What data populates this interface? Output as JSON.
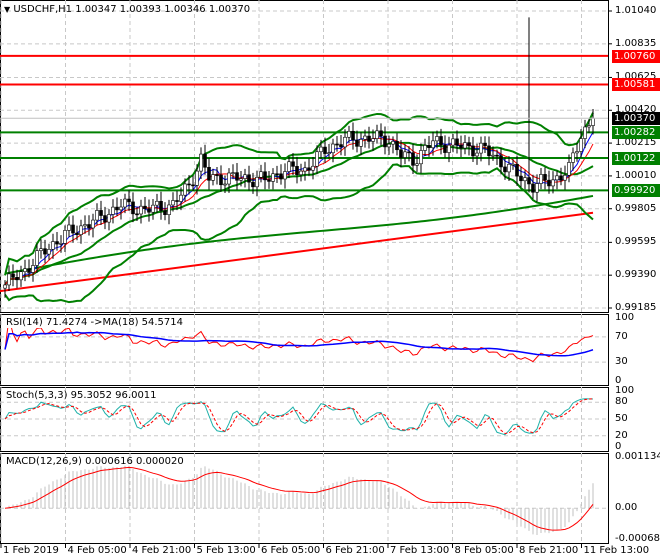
{
  "header": {
    "symbol": "USDCHF,H1",
    "ohlc": "1.00347 1.00393 1.00346 1.00370",
    "menu_icon": "triangle-down-icon"
  },
  "colors": {
    "support": "#008000",
    "resistance": "#ff0000",
    "bands": "#008000",
    "ma_fast": "#0000ff",
    "ma_slow": "#ff0000",
    "rsi": "#ff0000",
    "rsi_ma": "#0000ff",
    "stoch_main": "#20b2aa",
    "stoch_signal": "#ff0000",
    "macd_hist": "#c0c0c0",
    "macd_signal": "#ff0000",
    "current": "#000000"
  },
  "chart_data": [
    {
      "type": "candlestick",
      "title": "USDCHF,H1",
      "ylim": [
        0.99185,
        1.0104
      ],
      "yticks": [
        "1.01040",
        "1.00835",
        "1.00625",
        "1.00420",
        "1.00215",
        "1.00010",
        "0.99805",
        "0.99595",
        "0.99390",
        "0.99185"
      ],
      "close_keypoints": [
        [
          0,
          0.99329
        ],
        [
          5,
          0.99422
        ],
        [
          10,
          0.99547
        ],
        [
          15,
          0.99641
        ],
        [
          20,
          0.99703
        ],
        [
          25,
          0.99766
        ],
        [
          29,
          0.99828
        ],
        [
          35,
          0.99797
        ],
        [
          42,
          0.99828
        ],
        [
          46,
          0.99953
        ],
        [
          49,
          1.00109
        ],
        [
          51,
          0.99997
        ],
        [
          58,
          0.99997
        ],
        [
          65,
          0.99985
        ],
        [
          70,
          1.00047
        ],
        [
          75,
          1.00047
        ],
        [
          80,
          1.00172
        ],
        [
          85,
          1.00234
        ],
        [
          92,
          1.00247
        ],
        [
          96,
          1.00234
        ],
        [
          99,
          1.00141
        ],
        [
          102,
          1.00109
        ],
        [
          107,
          1.00222
        ],
        [
          112,
          1.00203
        ],
        [
          120,
          1.00172
        ],
        [
          125,
          1.00078
        ],
        [
          129,
          0.99997
        ],
        [
          132,
          0.99953
        ],
        [
          137,
          0.99985
        ],
        [
          141,
          1.00047
        ],
        [
          144,
          1.00266
        ],
        [
          147,
          1.0037
        ]
      ],
      "spike": {
        "bar": 131,
        "high": 1.01
      },
      "levels": [
        {
          "value": 1.0076,
          "label": "1.00760",
          "kind": "resistance"
        },
        {
          "value": 1.00581,
          "label": "1.00581",
          "kind": "resistance"
        },
        {
          "value": 1.00282,
          "label": "1.00282",
          "kind": "support"
        },
        {
          "value": 1.00122,
          "label": "1.00122",
          "kind": "support"
        },
        {
          "value": 0.9992,
          "label": "0.99920",
          "kind": "support"
        }
      ],
      "current": {
        "value": 1.0037,
        "label": "1.00370"
      },
      "long_ma_red": [
        0.9929,
        0.9978
      ],
      "long_ma_green": [
        0.994,
        0.999
      ]
    },
    {
      "type": "line",
      "title": "RSI(14) 71.4274  ->MA(18) 54.5714",
      "yticks": [
        "100",
        "70",
        "30",
        "0"
      ],
      "ylim": [
        0,
        100
      ]
    },
    {
      "type": "line",
      "title": "Stoch(5,3,3) 95.3052 96.0011",
      "yticks": [
        "100",
        "80",
        "50",
        "20",
        "0"
      ],
      "ylim": [
        0,
        100
      ]
    },
    {
      "type": "bar",
      "title": "MACD(12,26,9) 0.000616 0.000020",
      "yticks": [
        "0.001134",
        "0.00",
        "-0.000681"
      ],
      "ylim": [
        -0.000681,
        0.001134
      ]
    }
  ],
  "time_axis": [
    "1 Feb 2019",
    "4 Feb 05:00",
    "4 Feb 21:00",
    "5 Feb 13:00",
    "6 Feb 05:00",
    "6 Feb 21:00",
    "7 Feb 13:00",
    "8 Feb 05:00",
    "8 Feb 21:00",
    "11 Feb 13:00"
  ]
}
